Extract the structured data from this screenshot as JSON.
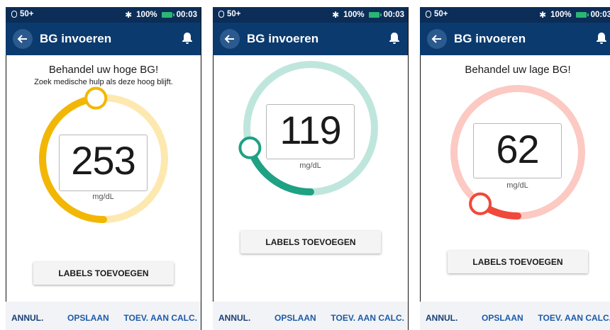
{
  "status": {
    "pod": "50+",
    "battery": "100%",
    "time": "00:03"
  },
  "appbar": {
    "title": "BG invoeren"
  },
  "screens": [
    {
      "heading": "Behandel uw hoge BG!",
      "subheading": "Zoek medische hulp als deze hoog blijft.",
      "value": "253",
      "unit": "mg/dL",
      "level": 0.48,
      "colors": {
        "track": "#fde9b0",
        "arc": "#f2b705",
        "handle": "#f2b705"
      }
    },
    {
      "heading": "",
      "subheading": "",
      "value": "119",
      "unit": "mg/dL",
      "level": 0.2,
      "colors": {
        "track": "#bfe6dd",
        "arc": "#1fa184",
        "handle": "#1fa184"
      }
    },
    {
      "heading": "Behandel uw lage BG!",
      "subheading": "",
      "value": "62",
      "unit": "mg/dL",
      "level": 0.1,
      "colors": {
        "track": "#fcc9c3",
        "arc": "#f0483a",
        "handle": "#f0483a"
      }
    }
  ],
  "labels_button": "LABELS TOEVOEGEN",
  "footer": {
    "cancel": "ANNUL.",
    "save": "OPSLAAN",
    "calc": "TOEV. AAN CALC."
  }
}
